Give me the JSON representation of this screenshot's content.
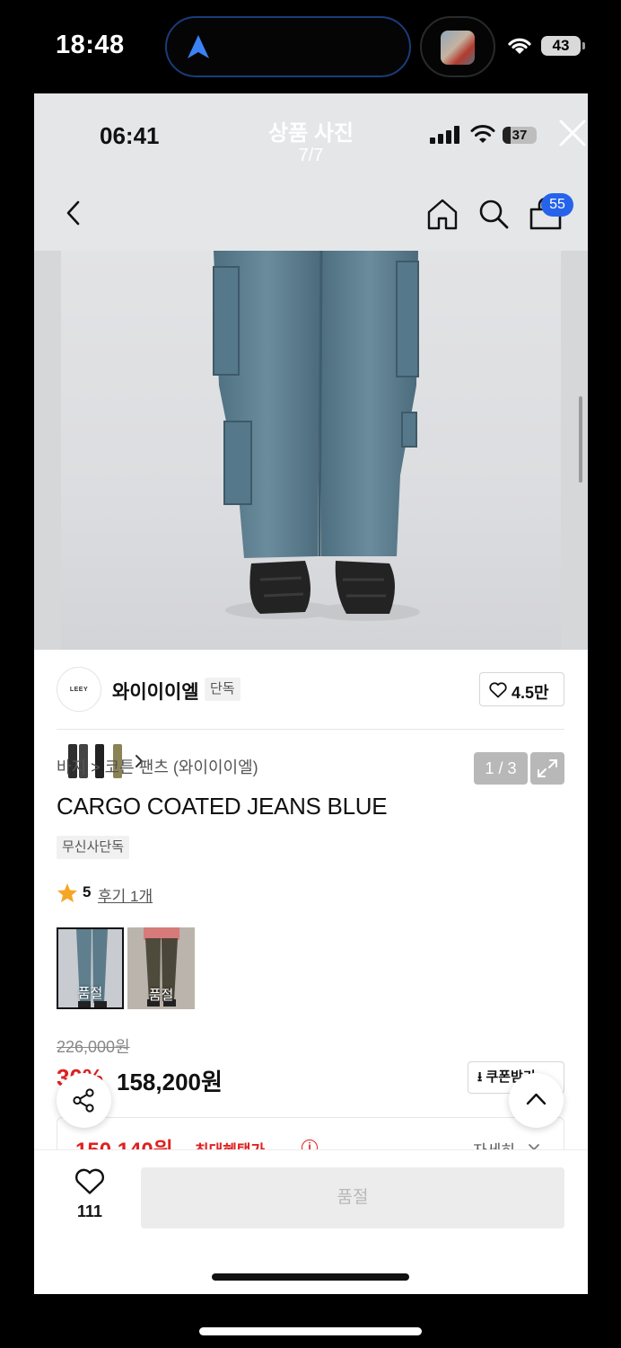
{
  "outer_status": {
    "time": "18:48",
    "battery": "43"
  },
  "viewer": {
    "time": "06:41",
    "title": "상품 사진",
    "counter": "7/7",
    "battery": "37"
  },
  "header": {
    "cart_count": "55"
  },
  "gallery": {
    "page_indicator": "1 / 3"
  },
  "brand": {
    "logo_text": "LEEY",
    "name": "와이이이엘",
    "tag": "단독",
    "likes": "4.5만"
  },
  "product": {
    "breadcrumb": "바지 > 코튼 팬츠 (와이이이엘)",
    "title": "CARGO COATED JEANS BLUE",
    "exclusive_badge": "무신사단독",
    "rating": "5",
    "review_link": "후기 1개",
    "variants": [
      {
        "label": "품절",
        "color": "#5f7f8f"
      },
      {
        "label": "품절",
        "color": "#4e4a3c"
      }
    ]
  },
  "pricing": {
    "original_price": "226,000원",
    "discount": "30%",
    "price": "158,200원",
    "coupon_label": "쿠폰받기",
    "benefit_price": "150,140원",
    "benefit_label": "최대혜택가",
    "detail_link": "자세히"
  },
  "bottom_bar": {
    "like_count": "111",
    "buy_label": "품절"
  },
  "colors": {
    "accent_red": "#e02020",
    "badge_blue": "#2563eb",
    "island_border": "#1a3c7a"
  }
}
